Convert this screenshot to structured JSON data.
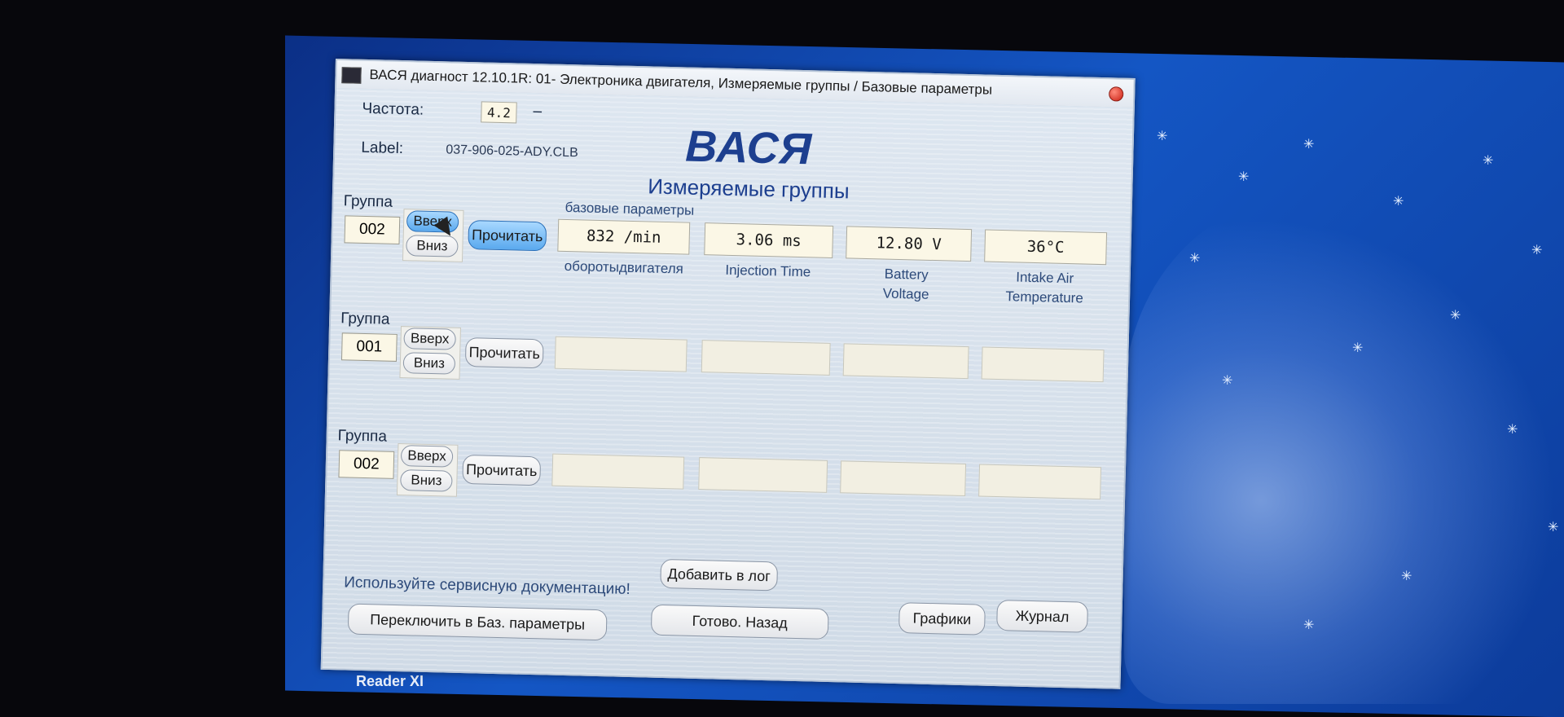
{
  "window": {
    "title": "ВАСЯ диагност 12.10.1R: 01- Электроника двигателя,  Измеряемые группы / Базовые параметры"
  },
  "header": {
    "freq_label": "Частота:",
    "freq_value": "4.2",
    "freq_unit": "–",
    "label_label": "Label:",
    "label_value": "037-906-025-ADY.CLB",
    "brand": "ВАСЯ",
    "subtitle": "Измеряемые группы",
    "basic_params_label": "базовые параметры"
  },
  "groups": [
    {
      "label": "Группа",
      "number": "002",
      "up": "Вверх",
      "down": "Вниз",
      "read": "Прочитать",
      "values": [
        "832 /min",
        "3.06 ms",
        "12.80 V",
        "36°C"
      ],
      "captions": [
        "оборотыдвигателя",
        "Injection Time",
        "Battery Voltage",
        "Intake Air Temperature"
      ]
    },
    {
      "label": "Группа",
      "number": "001",
      "up": "Вверх",
      "down": "Вниз",
      "read": "Прочитать",
      "values": [
        "",
        "",
        "",
        ""
      ],
      "captions": [
        "",
        "",
        "",
        ""
      ]
    },
    {
      "label": "Группа",
      "number": "002",
      "up": "Вверх",
      "down": "Вниз",
      "read": "Прочитать",
      "values": [
        "",
        "",
        "",
        ""
      ],
      "captions": [
        "",
        "",
        "",
        ""
      ]
    }
  ],
  "footer": {
    "notice": "Используйте сервисную документацию!",
    "add_to_log": "Добавить в лог",
    "switch_basic": "Переключить в Баз. параметры",
    "done_back": "Готово. Назад",
    "graphs": "Графики",
    "journal": "Журнал"
  },
  "desktop": {
    "taskbar_item": "Reader XI"
  },
  "icons": {
    "app": "app-logo-icon",
    "close": "close-icon",
    "cursor": "mouse-cursor-icon"
  }
}
